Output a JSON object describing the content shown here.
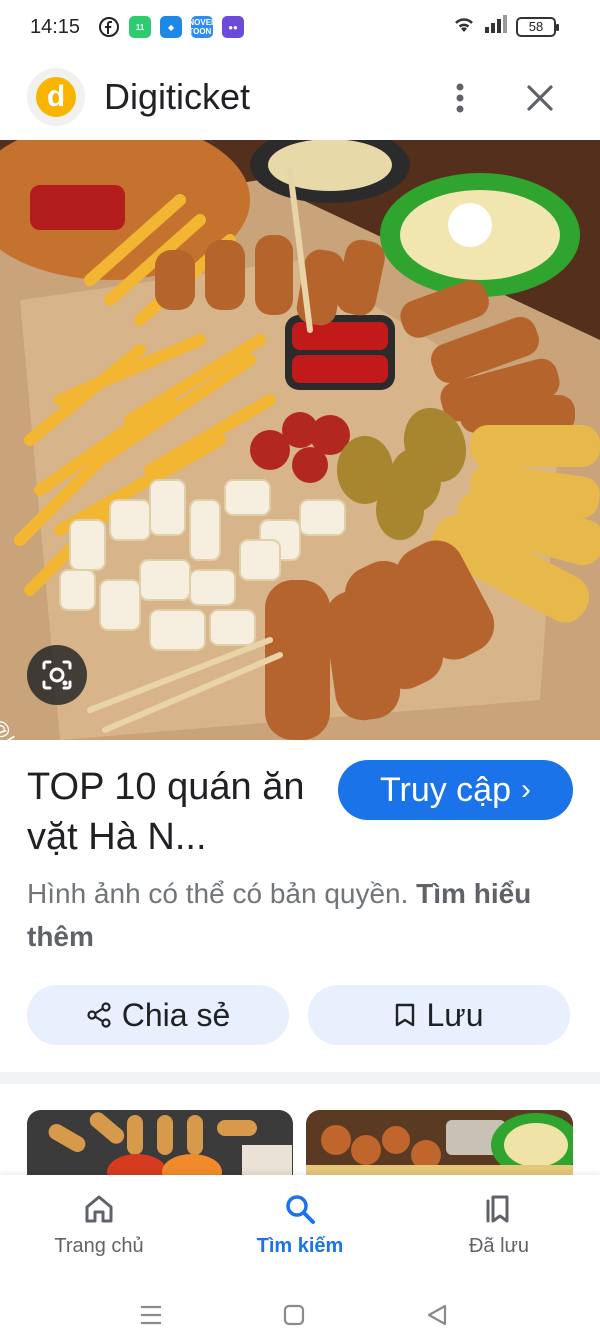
{
  "status_bar": {
    "time": "14:15",
    "battery": "58",
    "apps": [
      {
        "icon": "facebook-icon",
        "color": "#ffffff"
      },
      {
        "icon": "green-app-icon",
        "color": "#2ecc71"
      },
      {
        "icon": "blue-app-icon",
        "color": "#1e88e5"
      },
      {
        "icon": "novel-toon-icon",
        "color": "#2f8cf5",
        "text": "NOVEL TOON"
      },
      {
        "icon": "game-app-icon",
        "color": "#6c4bd8"
      }
    ]
  },
  "header": {
    "site_name": "Digiticket",
    "logo_letter": "d"
  },
  "hero": {
    "watermark": "@bacluaviahe"
  },
  "result": {
    "title": "TOP 10 quán ăn vặt Hà N...",
    "visit_label": "Truy cập",
    "visit_chevron": "›",
    "copyright_text": "Hình ảnh có thể có bản quyền.",
    "learn_more": "Tìm hiểu thêm"
  },
  "actions": {
    "share_label": "Chia sẻ",
    "save_label": "Lưu"
  },
  "bottom_nav": {
    "home_label": "Trang chủ",
    "search_label": "Tìm kiếm",
    "saved_label": "Đã lưu"
  },
  "colors": {
    "accent": "#1a73e8",
    "pill_bg": "#e8f0fe"
  }
}
